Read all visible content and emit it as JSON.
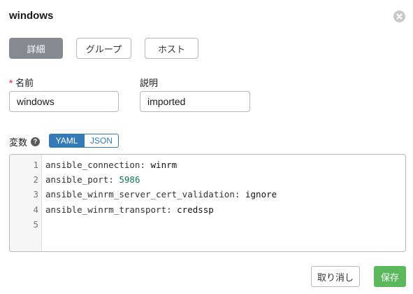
{
  "dialog": {
    "title": "windows"
  },
  "tabs": [
    {
      "label": "詳細",
      "active": true
    },
    {
      "label": "グループ",
      "active": false
    },
    {
      "label": "ホスト",
      "active": false
    }
  ],
  "form": {
    "name": {
      "required_mark": "*",
      "label": "名前",
      "value": "windows"
    },
    "description": {
      "label": "説明",
      "value": "imported"
    },
    "variables": {
      "label": "変数",
      "help_icon": "?",
      "format_options": [
        "YAML",
        "JSON"
      ],
      "selected_format": "YAML",
      "lines": [
        {
          "num": "1",
          "key": "ansible_connection",
          "colon": ":",
          "value": "winrm",
          "value_type": "string"
        },
        {
          "num": "2",
          "key": "ansible_port",
          "colon": ":",
          "value": "5986",
          "value_type": "number"
        },
        {
          "num": "3",
          "key": "ansible_winrm_server_cert_validation",
          "colon": ":",
          "value": "ignore",
          "value_type": "string"
        },
        {
          "num": "4",
          "key": "ansible_winrm_transport",
          "colon": ":",
          "value": "credssp",
          "value_type": "string"
        },
        {
          "num": "5",
          "key": "",
          "colon": "",
          "value": "",
          "value_type": "empty"
        }
      ]
    }
  },
  "footer": {
    "cancel_label": "取り消し",
    "save_label": "保存"
  },
  "colors": {
    "active_tab": "#848992",
    "toggle_selected": "#337ab7",
    "save_button": "#5cb85c",
    "required_mark": "#d9534f",
    "number_value": "#0f7a50"
  }
}
